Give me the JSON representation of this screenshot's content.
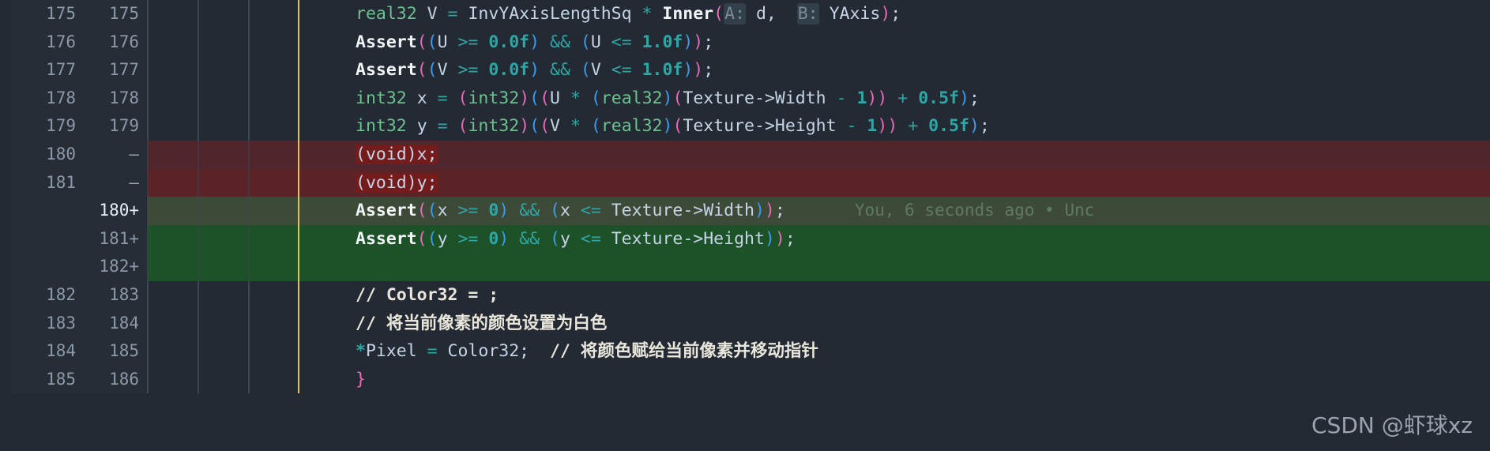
{
  "editor": {
    "theme_background": "#242a33",
    "gutter_background": "#272d37",
    "diff_added_background": "#1d5128",
    "diff_removed_background": "#5a2327",
    "active_indent_guide_color": "#e8c33c"
  },
  "watermark": {
    "text": "CSDN @虾球xz"
  },
  "blame": {
    "text": "You, 6 seconds ago • Unc"
  },
  "rows": [
    {
      "old_line": "175",
      "new_line": "175",
      "kind": "context",
      "tokens": [
        {
          "text": "real32",
          "cls": "t-type"
        },
        {
          "text": " ",
          "cls": "t-plain"
        },
        {
          "text": "V",
          "cls": "t-var"
        },
        {
          "text": " ",
          "cls": "t-plain"
        },
        {
          "text": "=",
          "cls": "t-op"
        },
        {
          "text": " ",
          "cls": "t-plain"
        },
        {
          "text": "InvYAxisLengthSq",
          "cls": "t-var"
        },
        {
          "text": " ",
          "cls": "t-plain"
        },
        {
          "text": "*",
          "cls": "t-op"
        },
        {
          "text": " ",
          "cls": "t-plain"
        },
        {
          "text": "Inner",
          "cls": "t-fn"
        },
        {
          "text": "(",
          "cls": "t-paren1"
        },
        {
          "text": "A:",
          "cls": "hint"
        },
        {
          "text": " ",
          "cls": "t-plain"
        },
        {
          "text": "d",
          "cls": "t-var"
        },
        {
          "text": ",",
          "cls": "t-punct"
        },
        {
          "text": "  ",
          "cls": "t-plain"
        },
        {
          "text": "B:",
          "cls": "hint"
        },
        {
          "text": " ",
          "cls": "t-plain"
        },
        {
          "text": "YAxis",
          "cls": "t-var"
        },
        {
          "text": ")",
          "cls": "t-paren1"
        },
        {
          "text": ";",
          "cls": "t-punct"
        }
      ]
    },
    {
      "old_line": "176",
      "new_line": "176",
      "kind": "context",
      "tokens": [
        {
          "text": "Assert",
          "cls": "t-fn"
        },
        {
          "text": "(",
          "cls": "t-paren1"
        },
        {
          "text": "(",
          "cls": "t-paren2"
        },
        {
          "text": "U",
          "cls": "t-var"
        },
        {
          "text": " ",
          "cls": "t-plain"
        },
        {
          "text": ">=",
          "cls": "t-op"
        },
        {
          "text": " ",
          "cls": "t-plain"
        },
        {
          "text": "0.0f",
          "cls": "t-num"
        },
        {
          "text": ")",
          "cls": "t-paren2"
        },
        {
          "text": " ",
          "cls": "t-plain"
        },
        {
          "text": "&&",
          "cls": "t-op"
        },
        {
          "text": " ",
          "cls": "t-plain"
        },
        {
          "text": "(",
          "cls": "t-paren2"
        },
        {
          "text": "U",
          "cls": "t-var"
        },
        {
          "text": " ",
          "cls": "t-plain"
        },
        {
          "text": "<=",
          "cls": "t-op"
        },
        {
          "text": " ",
          "cls": "t-plain"
        },
        {
          "text": "1.0f",
          "cls": "t-num"
        },
        {
          "text": ")",
          "cls": "t-paren2"
        },
        {
          "text": ")",
          "cls": "t-paren1"
        },
        {
          "text": ";",
          "cls": "t-punct"
        }
      ]
    },
    {
      "old_line": "177",
      "new_line": "177",
      "kind": "context",
      "tokens": [
        {
          "text": "Assert",
          "cls": "t-fn"
        },
        {
          "text": "(",
          "cls": "t-paren1"
        },
        {
          "text": "(",
          "cls": "t-paren2"
        },
        {
          "text": "V",
          "cls": "t-var"
        },
        {
          "text": " ",
          "cls": "t-plain"
        },
        {
          "text": ">=",
          "cls": "t-op"
        },
        {
          "text": " ",
          "cls": "t-plain"
        },
        {
          "text": "0.0f",
          "cls": "t-num"
        },
        {
          "text": ")",
          "cls": "t-paren2"
        },
        {
          "text": " ",
          "cls": "t-plain"
        },
        {
          "text": "&&",
          "cls": "t-op"
        },
        {
          "text": " ",
          "cls": "t-plain"
        },
        {
          "text": "(",
          "cls": "t-paren2"
        },
        {
          "text": "V",
          "cls": "t-var"
        },
        {
          "text": " ",
          "cls": "t-plain"
        },
        {
          "text": "<=",
          "cls": "t-op"
        },
        {
          "text": " ",
          "cls": "t-plain"
        },
        {
          "text": "1.0f",
          "cls": "t-num"
        },
        {
          "text": ")",
          "cls": "t-paren2"
        },
        {
          "text": ")",
          "cls": "t-paren1"
        },
        {
          "text": ";",
          "cls": "t-punct"
        }
      ]
    },
    {
      "old_line": "178",
      "new_line": "178",
      "kind": "context",
      "tokens": [
        {
          "text": "int32",
          "cls": "t-type"
        },
        {
          "text": " ",
          "cls": "t-plain"
        },
        {
          "text": "x",
          "cls": "t-var"
        },
        {
          "text": " ",
          "cls": "t-plain"
        },
        {
          "text": "=",
          "cls": "t-op"
        },
        {
          "text": " ",
          "cls": "t-plain"
        },
        {
          "text": "(",
          "cls": "t-paren1"
        },
        {
          "text": "int32",
          "cls": "t-type"
        },
        {
          "text": ")",
          "cls": "t-paren1"
        },
        {
          "text": "(",
          "cls": "t-paren2"
        },
        {
          "text": "(",
          "cls": "t-paren1"
        },
        {
          "text": "U",
          "cls": "t-var"
        },
        {
          "text": " ",
          "cls": "t-plain"
        },
        {
          "text": "*",
          "cls": "t-op"
        },
        {
          "text": " ",
          "cls": "t-plain"
        },
        {
          "text": "(",
          "cls": "t-paren2"
        },
        {
          "text": "real32",
          "cls": "t-type"
        },
        {
          "text": ")",
          "cls": "t-paren2"
        },
        {
          "text": "(",
          "cls": "t-paren1"
        },
        {
          "text": "Texture->Width",
          "cls": "t-var"
        },
        {
          "text": " ",
          "cls": "t-plain"
        },
        {
          "text": "-",
          "cls": "t-op"
        },
        {
          "text": " ",
          "cls": "t-plain"
        },
        {
          "text": "1",
          "cls": "t-num"
        },
        {
          "text": ")",
          "cls": "t-paren1"
        },
        {
          "text": ")",
          "cls": "t-paren1"
        },
        {
          "text": " ",
          "cls": "t-plain"
        },
        {
          "text": "+",
          "cls": "t-op"
        },
        {
          "text": " ",
          "cls": "t-plain"
        },
        {
          "text": "0.5f",
          "cls": "t-num"
        },
        {
          "text": ")",
          "cls": "t-paren2"
        },
        {
          "text": ";",
          "cls": "t-punct"
        }
      ]
    },
    {
      "old_line": "179",
      "new_line": "179",
      "kind": "context",
      "tokens": [
        {
          "text": "int32",
          "cls": "t-type"
        },
        {
          "text": " ",
          "cls": "t-plain"
        },
        {
          "text": "y",
          "cls": "t-var"
        },
        {
          "text": " ",
          "cls": "t-plain"
        },
        {
          "text": "=",
          "cls": "t-op"
        },
        {
          "text": " ",
          "cls": "t-plain"
        },
        {
          "text": "(",
          "cls": "t-paren1"
        },
        {
          "text": "int32",
          "cls": "t-type"
        },
        {
          "text": ")",
          "cls": "t-paren1"
        },
        {
          "text": "(",
          "cls": "t-paren2"
        },
        {
          "text": "(",
          "cls": "t-paren1"
        },
        {
          "text": "V",
          "cls": "t-var"
        },
        {
          "text": " ",
          "cls": "t-plain"
        },
        {
          "text": "*",
          "cls": "t-op"
        },
        {
          "text": " ",
          "cls": "t-plain"
        },
        {
          "text": "(",
          "cls": "t-paren2"
        },
        {
          "text": "real32",
          "cls": "t-type"
        },
        {
          "text": ")",
          "cls": "t-paren2"
        },
        {
          "text": "(",
          "cls": "t-paren1"
        },
        {
          "text": "Texture->Height",
          "cls": "t-var"
        },
        {
          "text": " ",
          "cls": "t-plain"
        },
        {
          "text": "-",
          "cls": "t-op"
        },
        {
          "text": " ",
          "cls": "t-plain"
        },
        {
          "text": "1",
          "cls": "t-num"
        },
        {
          "text": ")",
          "cls": "t-paren1"
        },
        {
          "text": ")",
          "cls": "t-paren1"
        },
        {
          "text": " ",
          "cls": "t-plain"
        },
        {
          "text": "+",
          "cls": "t-op"
        },
        {
          "text": " ",
          "cls": "t-plain"
        },
        {
          "text": "0.5f",
          "cls": "t-num"
        },
        {
          "text": ")",
          "cls": "t-paren2"
        },
        {
          "text": ";",
          "cls": "t-punct"
        }
      ]
    },
    {
      "old_line": "180",
      "new_line": "—",
      "kind": "removed",
      "soft": true,
      "tokens": [
        {
          "text": "(void)x;",
          "cls": "t-cast",
          "emph": true
        }
      ]
    },
    {
      "old_line": "181",
      "new_line": "—",
      "kind": "removed",
      "tokens": [
        {
          "text": "(void)y;",
          "cls": "t-cast",
          "emph": true
        }
      ]
    },
    {
      "old_line": "",
      "new_line": "180+",
      "kind": "added",
      "soft": true,
      "bright_line_number": true,
      "blame": true,
      "tokens": [
        {
          "text": "Assert",
          "cls": "t-fn"
        },
        {
          "text": "(",
          "cls": "t-paren1"
        },
        {
          "text": "(",
          "cls": "t-paren2"
        },
        {
          "text": "x",
          "cls": "t-var"
        },
        {
          "text": " ",
          "cls": "t-plain"
        },
        {
          "text": ">=",
          "cls": "t-op"
        },
        {
          "text": " ",
          "cls": "t-plain"
        },
        {
          "text": "0",
          "cls": "t-num"
        },
        {
          "text": ")",
          "cls": "t-paren2"
        },
        {
          "text": " ",
          "cls": "t-plain"
        },
        {
          "text": "&&",
          "cls": "t-op"
        },
        {
          "text": " ",
          "cls": "t-plain"
        },
        {
          "text": "(",
          "cls": "t-paren2"
        },
        {
          "text": "x",
          "cls": "t-var"
        },
        {
          "text": " ",
          "cls": "t-plain"
        },
        {
          "text": "<=",
          "cls": "t-op"
        },
        {
          "text": " ",
          "cls": "t-plain"
        },
        {
          "text": "Texture->Width",
          "cls": "t-var"
        },
        {
          "text": ")",
          "cls": "t-paren2"
        },
        {
          "text": ")",
          "cls": "t-paren1"
        },
        {
          "text": ";",
          "cls": "t-punct"
        }
      ]
    },
    {
      "old_line": "",
      "new_line": "181+",
      "kind": "added",
      "tokens": [
        {
          "text": "Assert",
          "cls": "t-fn"
        },
        {
          "text": "(",
          "cls": "t-paren1"
        },
        {
          "text": "(",
          "cls": "t-paren2"
        },
        {
          "text": "y",
          "cls": "t-var"
        },
        {
          "text": " ",
          "cls": "t-plain"
        },
        {
          "text": ">=",
          "cls": "t-op"
        },
        {
          "text": " ",
          "cls": "t-plain"
        },
        {
          "text": "0",
          "cls": "t-num"
        },
        {
          "text": ")",
          "cls": "t-paren2"
        },
        {
          "text": " ",
          "cls": "t-plain"
        },
        {
          "text": "&&",
          "cls": "t-op"
        },
        {
          "text": " ",
          "cls": "t-plain"
        },
        {
          "text": "(",
          "cls": "t-paren2"
        },
        {
          "text": "y",
          "cls": "t-var"
        },
        {
          "text": " ",
          "cls": "t-plain"
        },
        {
          "text": "<=",
          "cls": "t-op"
        },
        {
          "text": " ",
          "cls": "t-plain"
        },
        {
          "text": "Texture->Height",
          "cls": "t-var"
        },
        {
          "text": ")",
          "cls": "t-paren2"
        },
        {
          "text": ")",
          "cls": "t-paren1"
        },
        {
          "text": ";",
          "cls": "t-punct"
        }
      ]
    },
    {
      "old_line": "",
      "new_line": "182+",
      "kind": "added",
      "tokens": []
    },
    {
      "old_line": "182",
      "new_line": "183",
      "kind": "context",
      "tokens": [
        {
          "text": "// Color32 = ;",
          "cls": "t-comment"
        }
      ]
    },
    {
      "old_line": "183",
      "new_line": "184",
      "kind": "context",
      "tokens": [
        {
          "text": "// 将当前像素的颜色设置为白色",
          "cls": "t-comment"
        }
      ]
    },
    {
      "old_line": "184",
      "new_line": "185",
      "kind": "context",
      "tokens": [
        {
          "text": "*",
          "cls": "t-star"
        },
        {
          "text": "Pixel",
          "cls": "t-var"
        },
        {
          "text": " ",
          "cls": "t-plain"
        },
        {
          "text": "=",
          "cls": "t-op"
        },
        {
          "text": " ",
          "cls": "t-plain"
        },
        {
          "text": "Color32",
          "cls": "t-var"
        },
        {
          "text": ";",
          "cls": "t-punct"
        },
        {
          "text": "  ",
          "cls": "t-plain"
        },
        {
          "text": "// 将颜色赋给当前像素并移动指针",
          "cls": "t-comment"
        }
      ]
    },
    {
      "old_line": "185",
      "new_line": "186",
      "kind": "context",
      "tokens": [
        {
          "text": "}",
          "cls": "t-paren1"
        }
      ]
    }
  ]
}
